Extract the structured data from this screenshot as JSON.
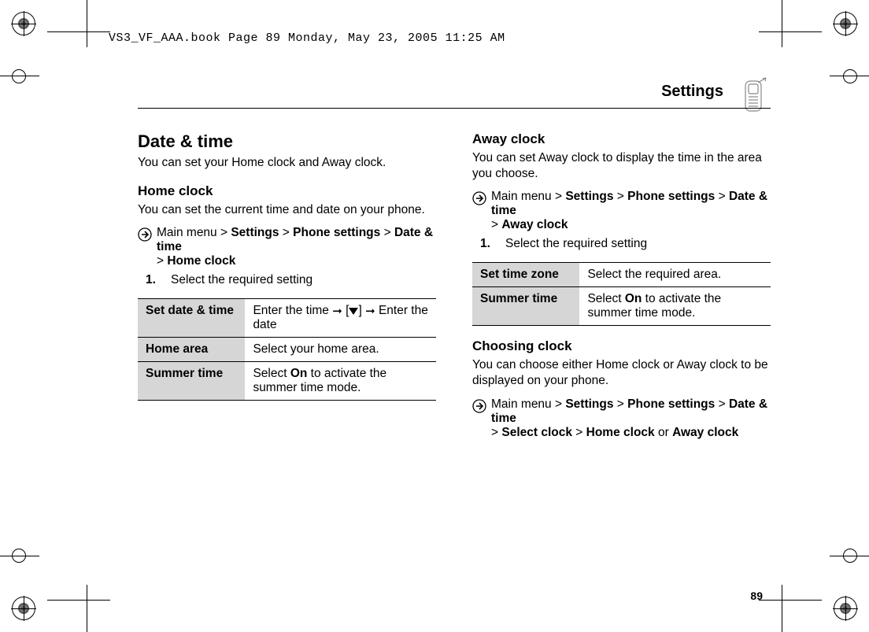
{
  "header": "VS3_VF_AAA.book  Page 89  Monday, May 23, 2005  11:25 AM",
  "page_title": "Settings",
  "page_number": "89",
  "left": {
    "h1": "Date & time",
    "intro": "You can set your Home clock and Away clock.",
    "h2": "Home clock",
    "p1": "You can set the current time and date on your phone.",
    "nav": {
      "pre": "Main menu > ",
      "b1": "Settings",
      "gt1": " > ",
      "b2": "Phone settings",
      "gt2": " > ",
      "b3": "Date & time",
      "gt3": " > ",
      "b4": "Home clock"
    },
    "step1_num": "1.",
    "step1": "Select the required setting",
    "table": [
      {
        "k": "Set date & time",
        "v_pre": "Enter the time ",
        "v_post": " Enter the date"
      },
      {
        "k": "Home area",
        "v": "Select your home area."
      },
      {
        "k": "Summer time",
        "v_pre": "Select ",
        "v_bold": "On",
        "v_post": " to activate the summer time mode."
      }
    ]
  },
  "right": {
    "h2a": "Away clock",
    "p1": "You can set Away clock to display the time in the area you choose.",
    "nav1": {
      "pre": "Main menu > ",
      "b1": "Settings",
      "gt1": " > ",
      "b2": "Phone settings",
      "gt2": " > ",
      "b3": "Date & time",
      "gt3": " > ",
      "b4": "Away clock"
    },
    "step1_num": "1.",
    "step1": "Select the required setting",
    "table": [
      {
        "k": "Set time zone",
        "v": "Select the required area."
      },
      {
        "k": "Summer time",
        "v_pre": "Select ",
        "v_bold": "On",
        "v_post": " to activate the summer time mode."
      }
    ],
    "h2b": "Choosing clock",
    "p2": "You can choose either Home clock or Away clock to be displayed on your phone.",
    "nav2": {
      "pre": "Main menu > ",
      "b1": "Settings",
      "gt1": " > ",
      "b2": "Phone settings",
      "gt2": " > ",
      "b3": "Date & time",
      "gt3": " > ",
      "b4": "Select clock",
      "gt4": " > ",
      "b5": "Home clock",
      "or": " or ",
      "b6": "Away clock"
    }
  }
}
